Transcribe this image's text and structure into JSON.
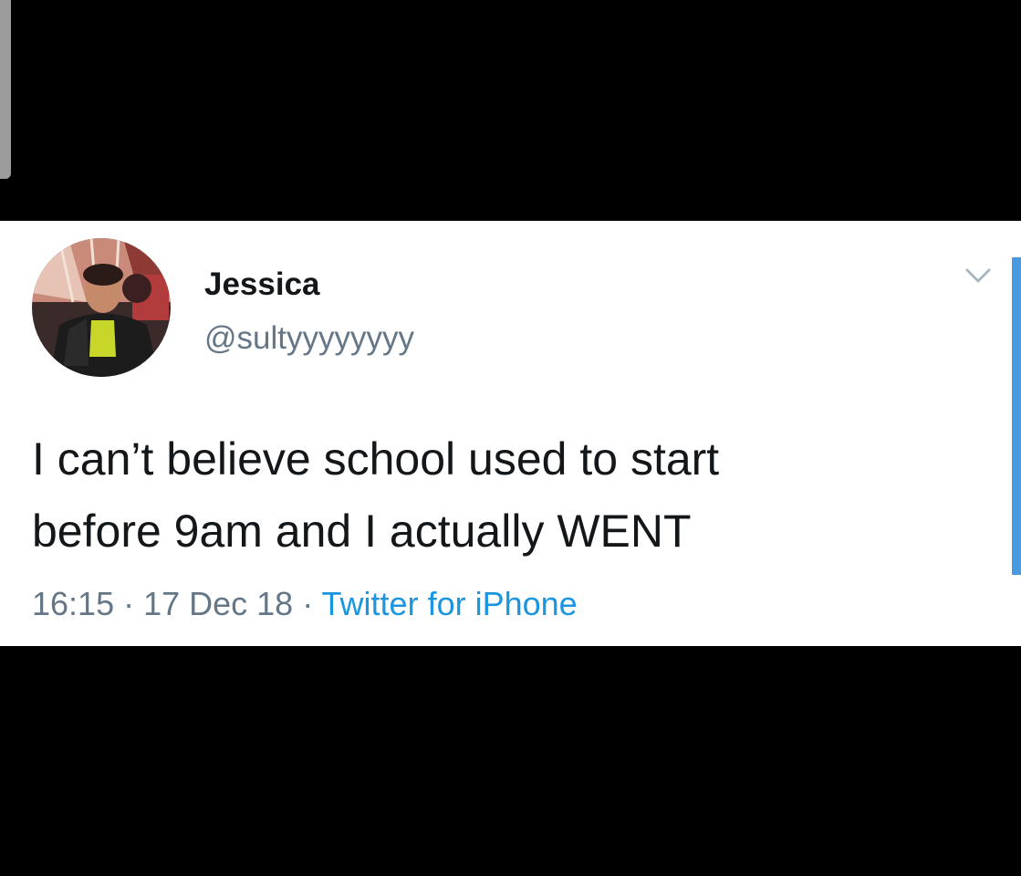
{
  "tweet": {
    "display_name": "Jessica",
    "handle": "@sultyyyyyyyy",
    "text_line_1": "I can’t believe school used to start",
    "text_line_2": "before 9am and I actually WENT",
    "time": "16:15",
    "separator": " · ",
    "date": "17 Dec 18",
    "source": "Twitter for iPhone"
  },
  "icons": {
    "menu": "chevron-down-icon"
  },
  "colors": {
    "card_background": "#ffffff",
    "page_background": "#000000",
    "name_text": "#14171a",
    "secondary_text": "#657786",
    "link_text": "#1b95e0",
    "accent_bar": "#4a9ae0"
  }
}
